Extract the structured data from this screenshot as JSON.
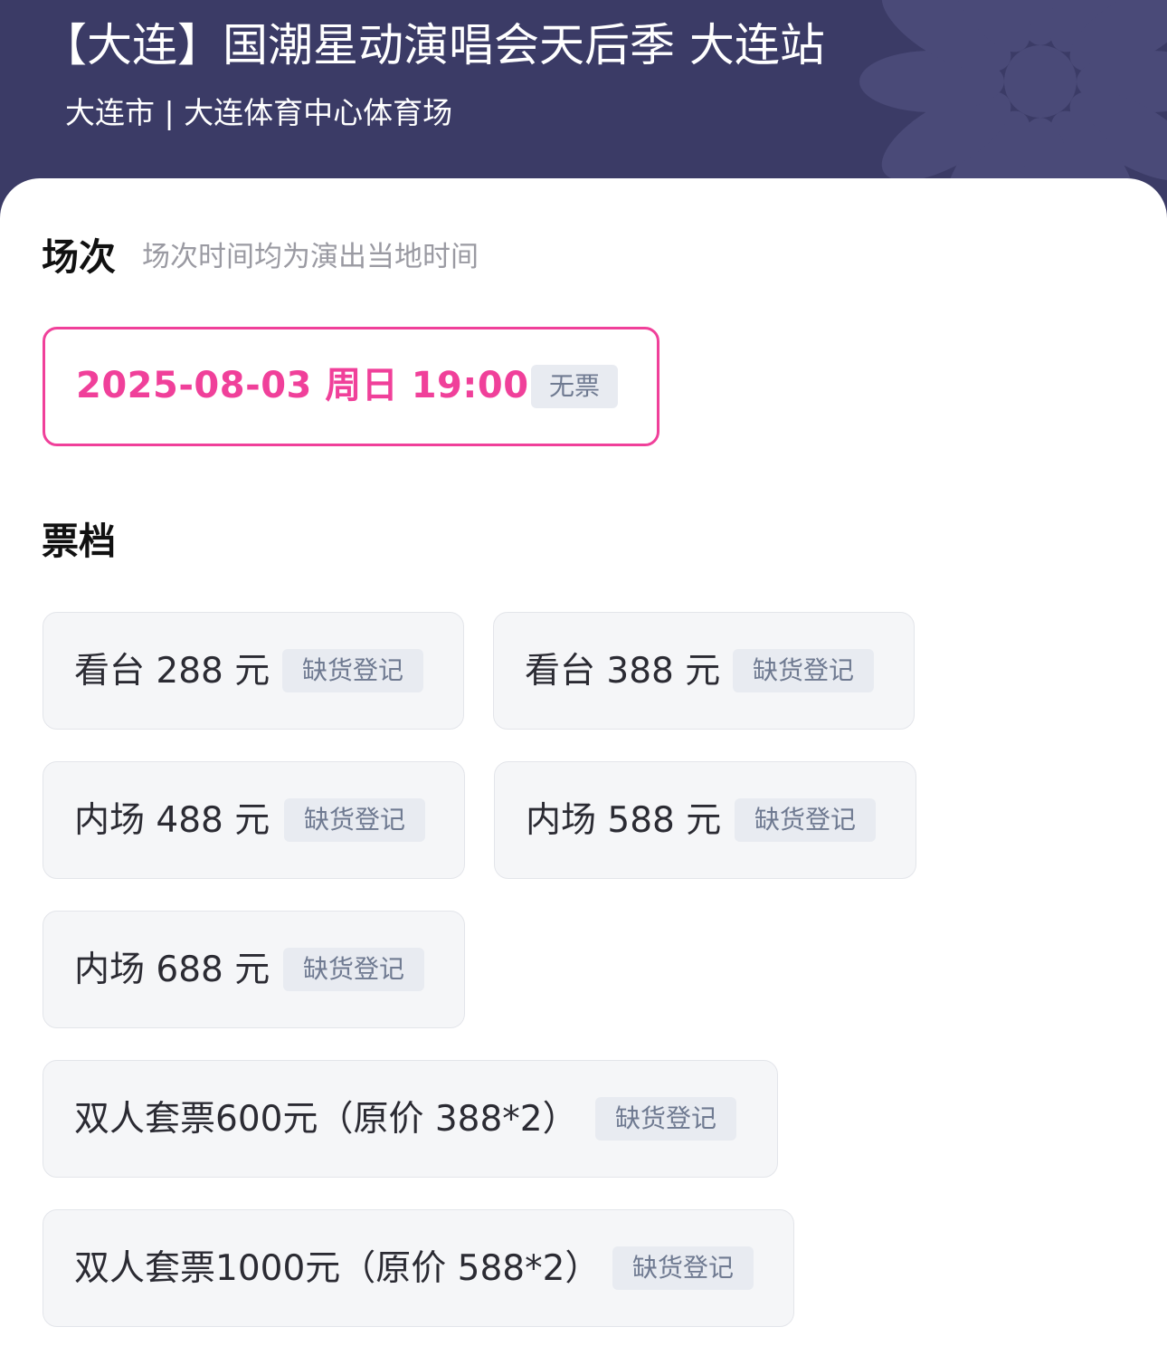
{
  "header": {
    "title": "【大连】国潮星动演唱会天后季 大连站",
    "venue": "大连市 | 大连体育中心体育场"
  },
  "sessions": {
    "heading": "场次",
    "note": "场次时间均为演出当地时间",
    "items": [
      {
        "datetime": "2025-08-03  周日 19:00",
        "status": "无票",
        "selected": true
      }
    ]
  },
  "tickets": {
    "heading": "票档",
    "items": [
      {
        "label": "看台 288 元",
        "status": "缺货登记"
      },
      {
        "label": "看台 388 元",
        "status": "缺货登记"
      },
      {
        "label": "内场 488 元",
        "status": "缺货登记"
      },
      {
        "label": "内场 588 元",
        "status": "缺货登记"
      },
      {
        "label": "内场 688 元",
        "status": "缺货登记"
      },
      {
        "label": "双人套票600元（原价 388*2）",
        "status": "缺货登记"
      },
      {
        "label": "双人套票1000元（原价 588*2）",
        "status": "缺货登记"
      }
    ]
  },
  "colors": {
    "header_bg": "#3b3b66",
    "accent_pink": "#f0409a",
    "badge_bg": "#e8ebf1",
    "badge_text": "#6f7a91",
    "card_bg": "#f5f6f8"
  }
}
